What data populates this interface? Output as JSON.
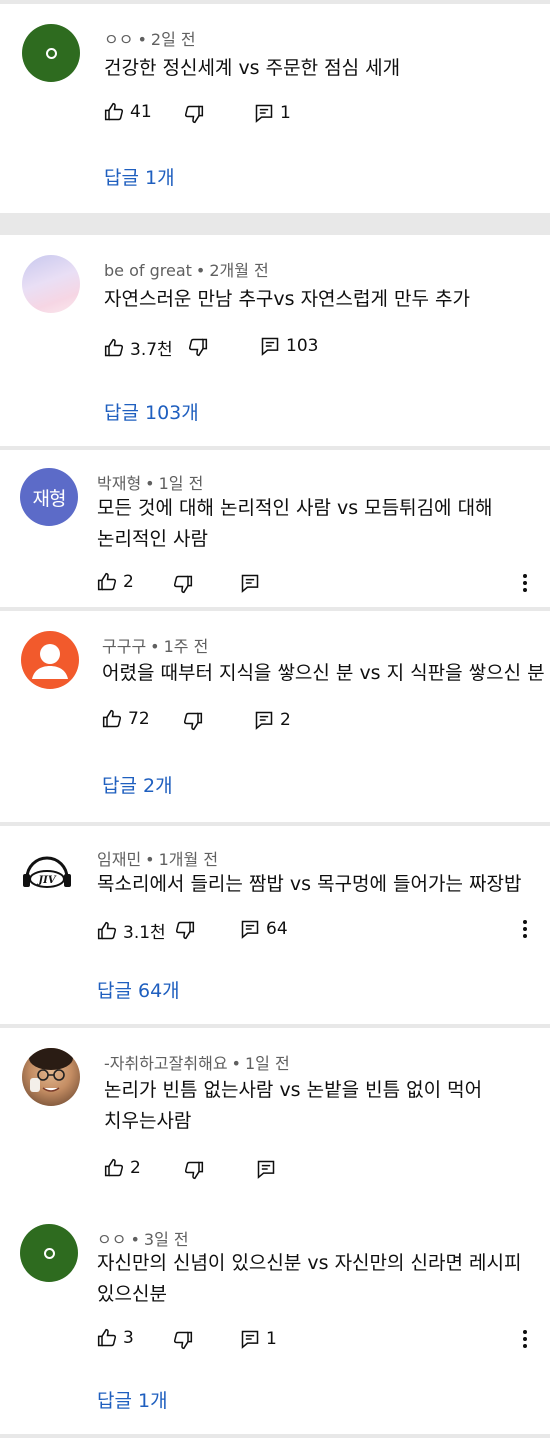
{
  "comments": [
    {
      "author": "ㅇㅇ",
      "time": "2일 전",
      "text": [
        "건강한 정신세계 vs 주문한 점심 세개"
      ],
      "likes": "41",
      "reply_count": "1",
      "replies_label": "답글 1개",
      "avatar": "o"
    },
    {
      "author": "be of great",
      "time": "2개월 전",
      "text": [
        "자연스러운 만남 추구vs 자연스럽게 만두 추가"
      ],
      "likes": "3.7천",
      "reply_count": "103",
      "replies_label": "답글 103개",
      "avatar": "cloud"
    },
    {
      "author": "박재형",
      "time": "1일 전",
      "text": [
        "모든 것에 대해 논리적인 사람 vs 모듬튀김에 대해",
        "논리적인 사람"
      ],
      "likes": "2",
      "avatar": "text",
      "avatar_text": "재형"
    },
    {
      "author": "구구구",
      "time": "1주 전",
      "text": [
        "어렸을 때부터 지식을 쌓으신 분 vs 지 식판을 쌓으신 분"
      ],
      "likes": "72",
      "reply_count": "2",
      "replies_label": "답글 2개",
      "avatar": "person-icon"
    },
    {
      "author": "임재민",
      "time": "1개월 전",
      "text": [
        "목소리에서 들리는 짬밥 vs 목구멍에 들어가는 짜장밥"
      ],
      "likes": "3.1천",
      "reply_count": "64",
      "replies_label": "답글 64개",
      "avatar": "jiv",
      "avatar_text": "JIV"
    },
    {
      "author": "-자취하고잘취해요",
      "time": "1일 전",
      "text": [
        "논리가 빈틈 없는사람 vs 논밭을 빈틈 없이 먹어",
        "치우는사람"
      ],
      "likes": "2",
      "avatar": "photo"
    },
    {
      "author": "ㅇㅇ",
      "time": "3일 전",
      "text": [
        "자신만의 신념이 있으신분 vs 자신만의 신라면 레시피",
        "있으신분"
      ],
      "likes": "3",
      "reply_count": "1",
      "replies_label": "답글 1개",
      "avatar": "o"
    }
  ],
  "colors": {
    "reply_link": "#1f5fbf",
    "meta": "#606060",
    "divider": "#e8e8e8"
  }
}
